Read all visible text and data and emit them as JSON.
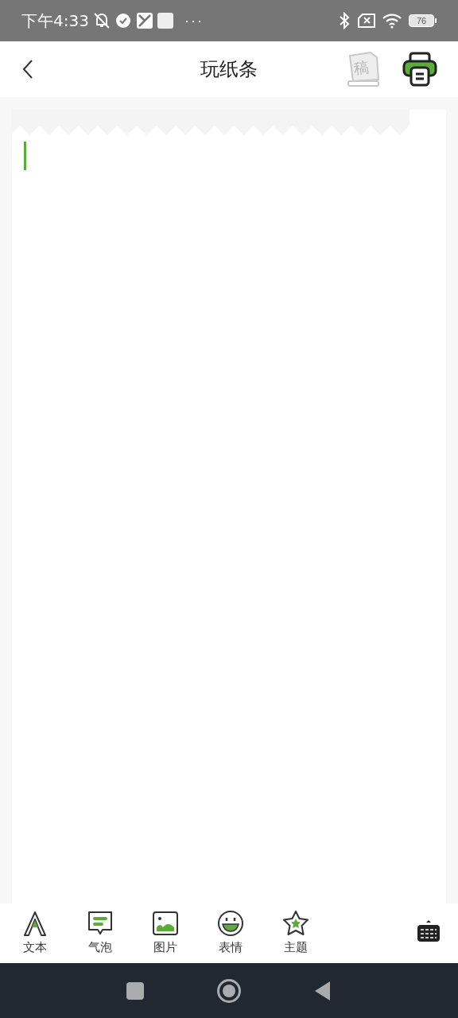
{
  "status_bar": {
    "time": "下午4:33",
    "more": "···",
    "battery": "76"
  },
  "header": {
    "title": "玩纸条",
    "draft_label": "稿"
  },
  "tools": [
    {
      "kind": "text",
      "label": "文本"
    },
    {
      "kind": "bubble",
      "label": "气泡"
    },
    {
      "kind": "image",
      "label": "图片"
    },
    {
      "kind": "emoji",
      "label": "表情"
    },
    {
      "kind": "theme",
      "label": "主题"
    }
  ]
}
